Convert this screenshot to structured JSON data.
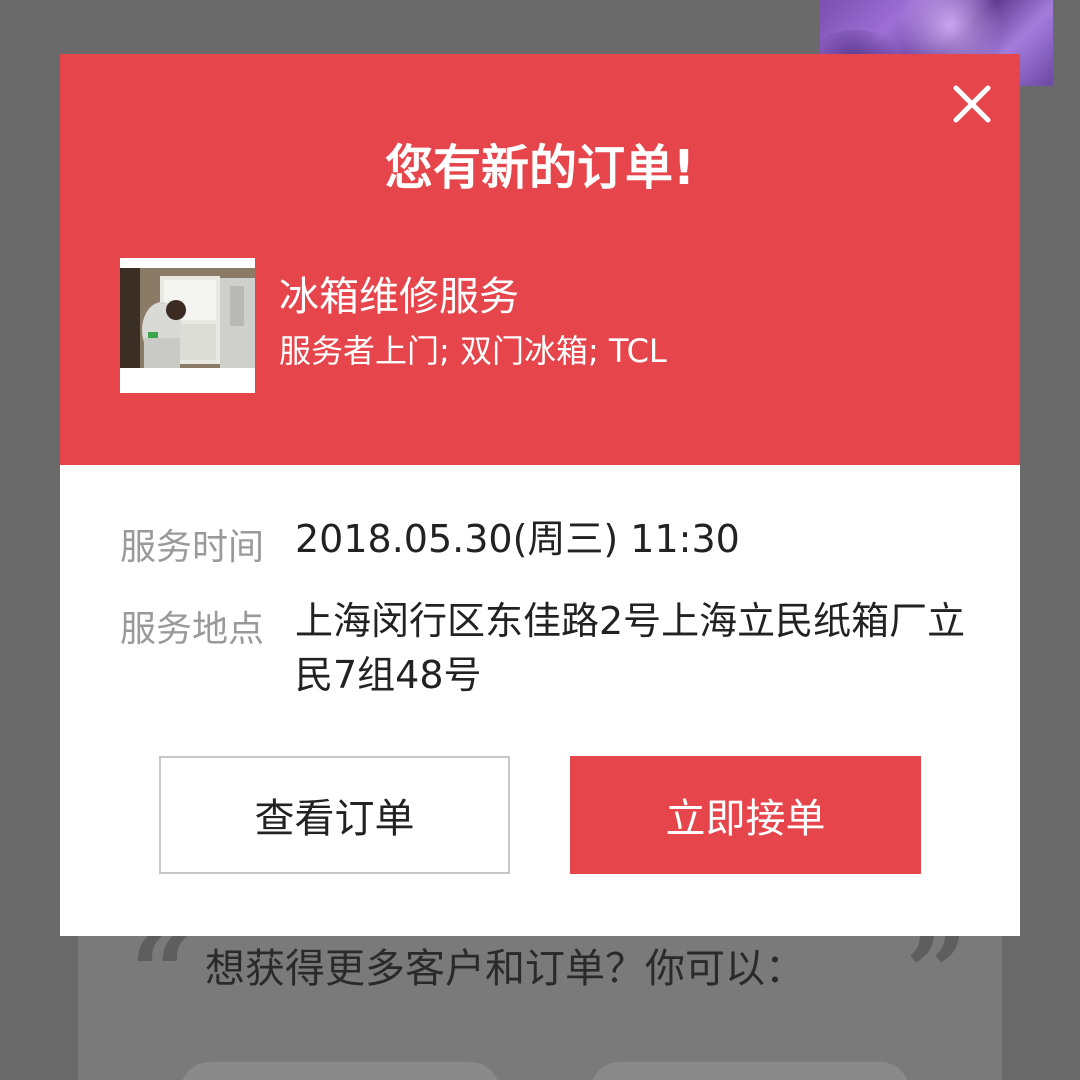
{
  "background": {
    "prompt_text": "想获得更多客户和订单？你可以：",
    "quote_open": "“",
    "quote_close": "”"
  },
  "dialog": {
    "title": "您有新的订单!",
    "close_icon": "close-icon",
    "service": {
      "image_icon": "fridge-repair-photo",
      "name": "冰箱维修服务",
      "tags": "服务者上门; 双门冰箱; TCL"
    },
    "details": {
      "time_label": "服务时间",
      "time_value": "2018.05.30(周三) 11:30",
      "address_label": "服务地点",
      "address_value": "上海闵行区东佳路2号上海立民纸箱厂立民7组48号"
    },
    "buttons": {
      "view_order": "查看订单",
      "accept_order": "立即接单"
    }
  },
  "colors": {
    "accent": "#e5454b",
    "overlay": "#6a6a6a",
    "label_gray": "#9a9a9a",
    "text_dark": "#222222"
  }
}
